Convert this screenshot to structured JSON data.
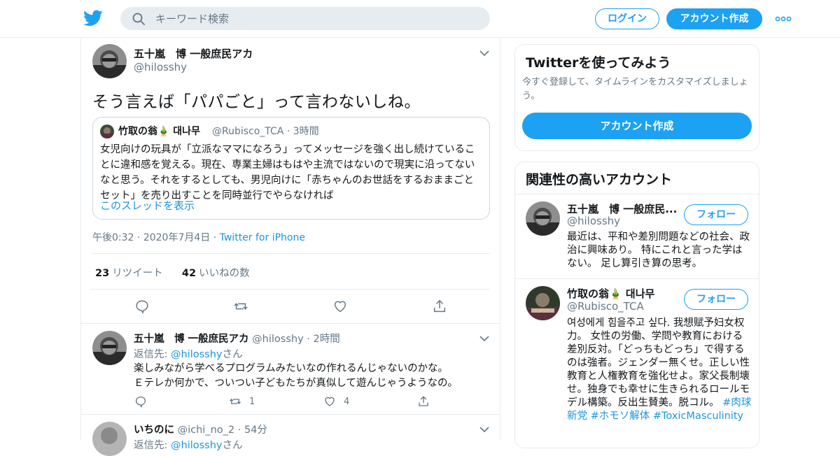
{
  "header": {
    "search_placeholder": "キーワード検索",
    "login_label": "ログイン",
    "signup_label": "アカウント作成"
  },
  "tweet": {
    "name": "五十嵐　博 一般庶民アカ",
    "handle": "@hilosshy",
    "text": "そう言えば「パパごと」って言わないしね。",
    "quote": {
      "name": "竹取の翁🎍 대나무",
      "handle": "@Rubisco_TCA",
      "time": "3時間",
      "text": "女児向けの玩具が「立派なママになろう」ってメッセージを強く出し続けていることに違和感を覚える。現在、専業主婦はもはや主流ではないので現実に沿ってないなと思う。それをするとしても、男児向けに「赤ちゃんのお世話をするおままごとセット」を売り出すことを同時並行でやらなければ",
      "thread_link": "このスレッドを表示"
    },
    "time": "午後0:32",
    "date": "2020年7月4日",
    "source": "Twitter for iPhone",
    "retweet_count": "23",
    "retweet_label": "リツイート",
    "like_count": "42",
    "like_label": "いいねの数"
  },
  "replies": [
    {
      "name": "五十嵐　博 一般庶民アカ",
      "handle": "@hilosshy",
      "time": "2時間",
      "reply_prefix": "返信先: ",
      "reply_to": "@hilosshy",
      "reply_suffix": "さん",
      "text_line1": "楽しみながら学べるプログラムみたいなの作れるんじゃないのかな。",
      "text_line2": "Ｅテレか何かで、ついつい子どもたちが真似して遊んじゃうようなの。",
      "retweets": "1",
      "likes": "4"
    },
    {
      "name": "いちのに",
      "handle": "@ichi_no_2",
      "time": "54分",
      "reply_prefix": "返信先: ",
      "reply_to": "@hilosshy",
      "reply_suffix": "さん"
    }
  ],
  "sidebar": {
    "signup_card": {
      "title": "Twitterを使ってみよう",
      "subtitle": "今すぐ登録して、タイムラインをカスタマイズしましょう。",
      "button": "アカウント作成"
    },
    "related": {
      "title": "関連性の高いアカウント",
      "follow_label": "フォロー",
      "accounts": [
        {
          "name": "五十嵐　博 一般庶民...",
          "handle": "@hilosshy",
          "bio": "最近は、平和や差別問題などの社会、政治に興味あり。 特にこれと言った学はない。 足し算引き算の思考。"
        },
        {
          "name": "竹取の翁🎍 대나무",
          "handle": "@Rubisco_TCA",
          "bio": "여성에게 힘을주고 싶다. 我想赋予妇女权力。 女性の労働、学問や教育における差別反対。「どっちもどっち」で得するのは強者。ジェンダー無くせ。正しい性教育と人権教育を強化せよ。家父長制壊せ。独身でも幸せに生きられるロールモデル構築。反出生賛美。脱コル。 ",
          "tags": [
            "#肉球新党",
            "#ホモソ解体",
            "#ToxicMasculinity"
          ]
        }
      ]
    }
  },
  "colors": {
    "accent": "#1da1f2",
    "link": "#1b95e0",
    "muted": "#657786",
    "border": "#e6ecf0"
  }
}
